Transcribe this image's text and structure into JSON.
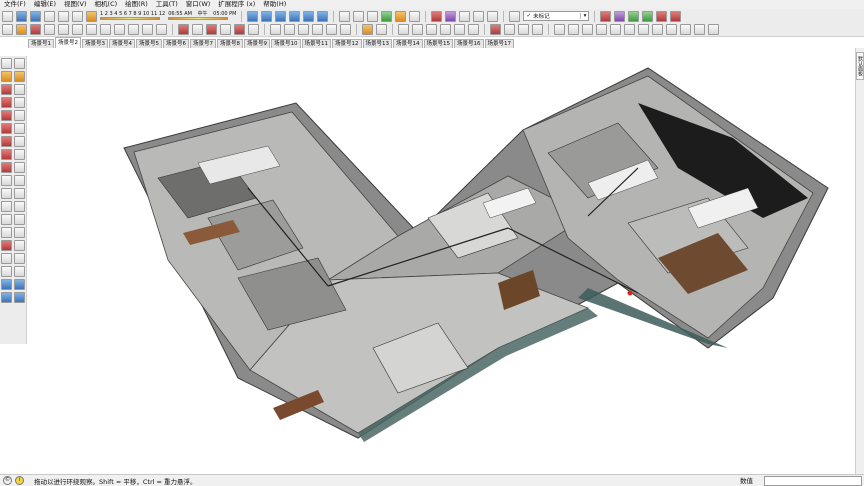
{
  "menubar": {
    "items": [
      "文件(F)",
      "编辑(E)",
      "视图(V)",
      "相机(C)",
      "绘图(R)",
      "工具(T)",
      "窗口(W)",
      "扩展程序 (x)",
      "帮助(H)"
    ]
  },
  "toolbar": {
    "shadow_scale": "J F M A M J J A S O N D",
    "shadow_scale_nums": "1 2 3 4 5 6 7 8 9 10 11 12",
    "time_start": "06:55 AM",
    "time_noon": "中午",
    "time_end": "05:00 PM",
    "tag_value": "未标记"
  },
  "scene_tabs": {
    "active_index": 1,
    "items": [
      "场景号1",
      "场景号2",
      "场景号3",
      "场景号4",
      "场景号5",
      "场景号6",
      "场景号7",
      "场景号8",
      "场景号9",
      "场景号10",
      "场景号11",
      "场景号12",
      "场景号13",
      "场景号14",
      "场景号15",
      "场景号16",
      "场景号17"
    ]
  },
  "right_tray": {
    "tab_label": "默认面板"
  },
  "statusbar": {
    "text": "拖动以进行环绕观察。Shift = 平移，Ctrl = 重力悬浮。",
    "measurements_label": "数值",
    "measurements_value": ""
  },
  "viewport": {
    "content": "3D floor plan model of office interior"
  }
}
